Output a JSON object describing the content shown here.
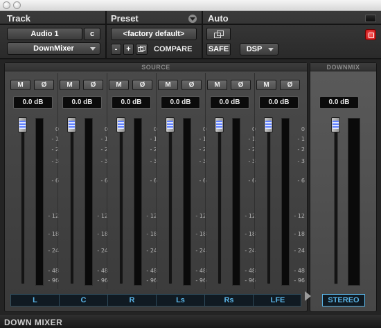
{
  "header": {
    "track_label": "Track",
    "preset_label": "Preset",
    "auto_label": "Auto",
    "track_name": "Audio 1",
    "track_channel": "c",
    "plugin_name": "DownMixer",
    "preset_value": "<factory default>",
    "minus_label": "-",
    "plus_label": "+",
    "compare_label": "COMPARE",
    "safe_label": "SAFE",
    "dsp_label": "DSP"
  },
  "source": {
    "title": "SOURCE",
    "channels": [
      {
        "name": "L",
        "mute": "M",
        "phase": "Ø",
        "gain": "0.0 dB",
        "fader_db": 0.0
      },
      {
        "name": "C",
        "mute": "M",
        "phase": "Ø",
        "gain": "0.0 dB",
        "fader_db": 0.0
      },
      {
        "name": "R",
        "mute": "M",
        "phase": "Ø",
        "gain": "0.0 dB",
        "fader_db": 0.0
      },
      {
        "name": "Ls",
        "mute": "M",
        "phase": "Ø",
        "gain": "0.0 dB",
        "fader_db": 0.0
      },
      {
        "name": "Rs",
        "mute": "M",
        "phase": "Ø",
        "gain": "0.0 dB",
        "fader_db": 0.0
      },
      {
        "name": "LFE",
        "mute": "M",
        "phase": "Ø",
        "gain": "0.0 dB",
        "fader_db": 0.0
      }
    ],
    "scale": [
      "0",
      "- 1",
      "- 2",
      "- 3",
      "- 6",
      "- 12",
      "- 18",
      "- 24",
      "- 48",
      "- 96"
    ]
  },
  "downmix": {
    "title": "DOWNMIX",
    "gain": "0.0 dB",
    "output": "STEREO",
    "fader_db": 0.0
  },
  "footer": {
    "title": "DOWN MIXER"
  },
  "colors": {
    "accent": "#5ab4e6",
    "fader_led": "#5f80ff",
    "close_button": "#e02020"
  }
}
